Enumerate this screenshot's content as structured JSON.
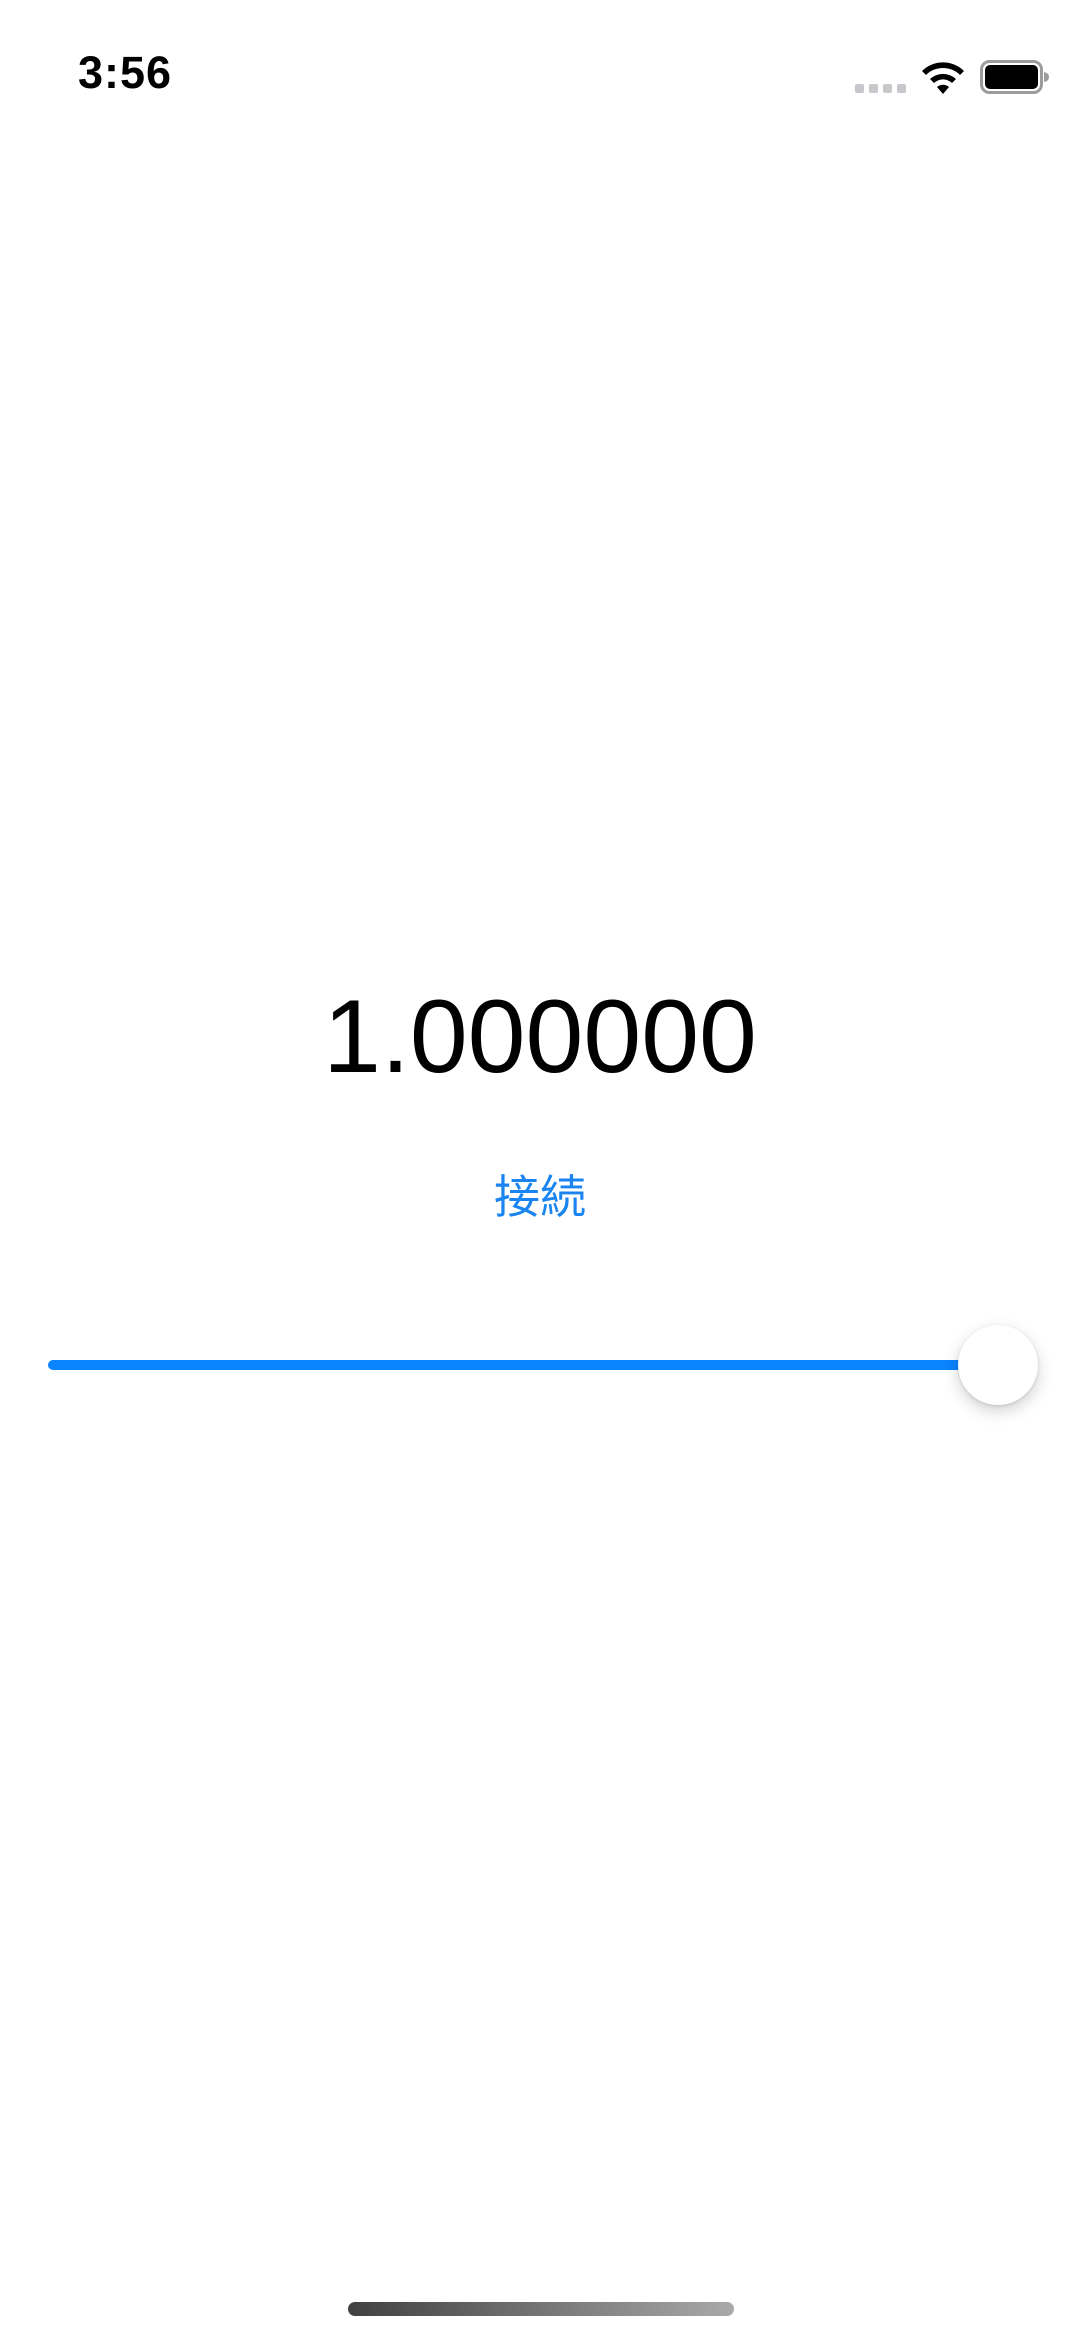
{
  "status_bar": {
    "time": "3:56",
    "icons": [
      "signal-dots-icon",
      "wifi-icon",
      "battery-icon"
    ]
  },
  "main": {
    "value_text": "1.000000",
    "connect_label": "接続"
  },
  "slider": {
    "value": 1.0,
    "min": 0.0,
    "max": 1.0
  },
  "colors": {
    "accent": "#0a84ff",
    "button_text": "#1a84f0",
    "track": "#e5e5ea"
  }
}
